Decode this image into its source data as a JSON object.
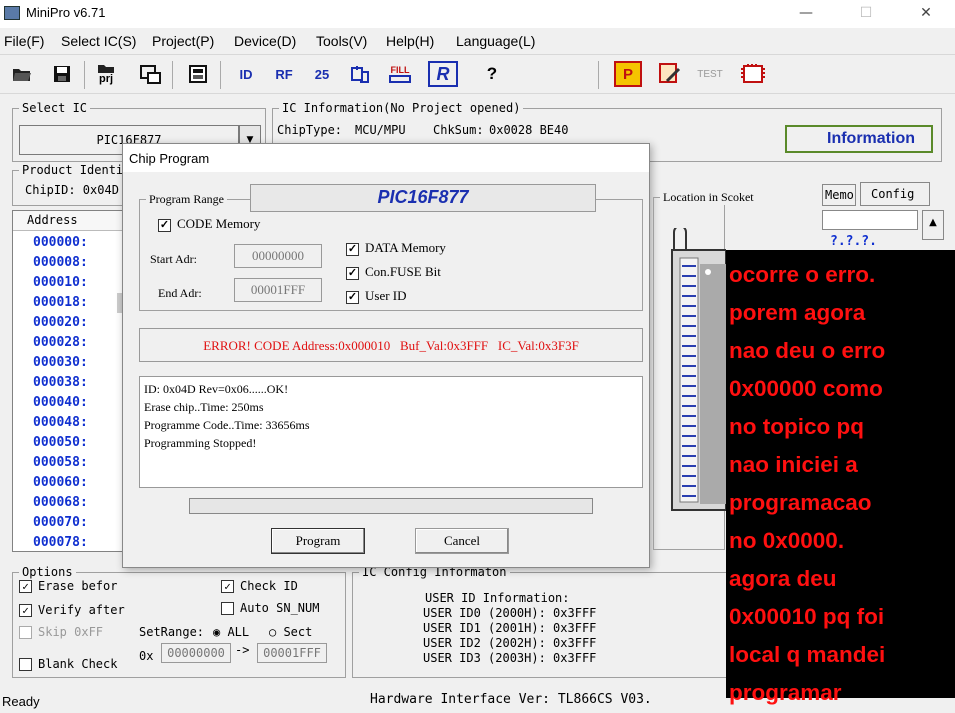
{
  "window": {
    "title": "MiniPro v6.71",
    "minimize": "—",
    "maximize": "☐",
    "close": "✕"
  },
  "menu": [
    "File(F)",
    "Select IC(S)",
    "Project(P)",
    "Device(D)",
    "Tools(V)",
    "Help(H)",
    "Language(L)"
  ],
  "toolbar": {
    "prj_label": "prj",
    "fill_label": "FILL",
    "test_label": "TEST",
    "r_label": "R",
    "p_label": "P",
    "help_label": "?"
  },
  "select_ic": {
    "label": "Select IC",
    "value": "PIC16F877"
  },
  "ic_info": {
    "label": "IC Information(No Project opened)",
    "chip_type_label": "ChipType:",
    "chip_type": "MCU/MPU",
    "checksum_label": "ChkSum:",
    "checksum": "0x0028 BE40",
    "info_button": "Information"
  },
  "product_identi": {
    "label": "Product Identi",
    "chip_id": "ChipID: 0x04D"
  },
  "tabs": {
    "memo": "Memo",
    "config": "Config"
  },
  "right_partial": "?.?.?.",
  "address_table": {
    "header": "Address",
    "rows": [
      "000000:",
      "000008:",
      "000010:",
      "000018:",
      "000020:",
      "000028:",
      "000030:",
      "000038:",
      "000040:",
      "000048:",
      "000050:",
      "000058:",
      "000060:",
      "000068:",
      "000070:",
      "000078:"
    ]
  },
  "dialog": {
    "title": "Chip Program",
    "program_range_label": "Program Range",
    "chip_name": "PIC16F877",
    "code_memory": "CODE Memory",
    "data_memory": "DATA Memory",
    "con_fuse_bit": "Con.FUSE Bit",
    "user_id": "User ID",
    "start_adr_label": "Start Adr:",
    "start_adr": "00000000",
    "end_adr_label": "End Adr:",
    "end_adr": "00001FFF",
    "error": "ERROR! CODE Address:0x000010   Buf_Val:0x3FFF   IC_Val:0x3F3F",
    "log": [
      "ID: 0x04D Rev=0x06......OK!",
      "Erase chip..Time: 250ms",
      "Programme Code..Time: 33656ms",
      "Programming Stopped!"
    ],
    "program_button": "Program",
    "cancel_button": "Cancel",
    "location_label": "Location in Scoket"
  },
  "options": {
    "label": "Options",
    "erase_before": "Erase befor",
    "verify_after": "Verify after",
    "skip_0xff": "Skip 0xFF",
    "blank_check": "Blank Check",
    "check_id": "Check ID",
    "auto_sn_num": "Auto SN_NUM",
    "set_range_label": "SetRange:",
    "range_all": "ALL",
    "range_sect": "Sect",
    "range_prefix": "0x",
    "range_start": "00000000",
    "range_arrow": "->",
    "range_end": "00001FFF"
  },
  "ic_config": {
    "label": "IC Config Informaton",
    "header": "USER ID Information:",
    "lines": [
      "USER ID0 (2000H): 0x3FFF",
      "USER ID1 (2001H): 0x3FFF",
      "USER ID2 (2002H): 0x3FFF",
      "USER ID3 (2003H): 0x3FFF"
    ]
  },
  "status": {
    "ready": "Ready",
    "hardware": "Hardware Interface Ver: TL866CS V03."
  },
  "overlay_note": [
    "ocorre o erro.",
    "porem agora",
    "nao deu o erro",
    "0x00000 como",
    "no topico pq",
    "nao iniciei a",
    "programacao",
    "no 0x0000.",
    "agora deu",
    "0x00010 pq foi",
    "local q mandei",
    "programar"
  ],
  "colors": {
    "address_blue": "#1030d0",
    "error_red": "#e01010",
    "note_red": "#ff1010",
    "note_bg": "#000000"
  }
}
